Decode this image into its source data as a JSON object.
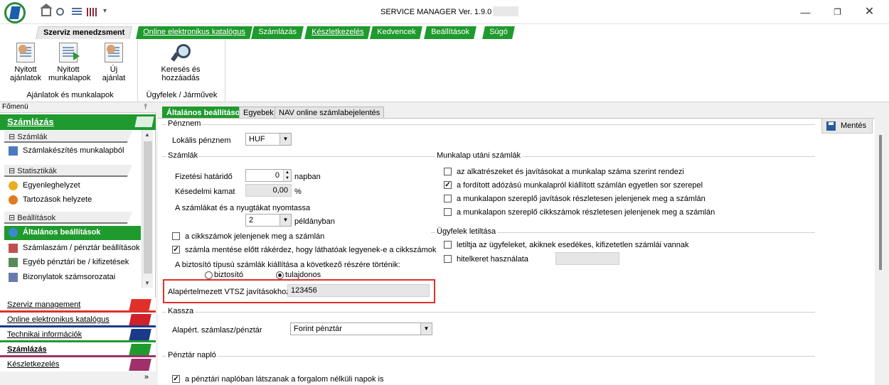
{
  "window": {
    "title": "SERVICE MANAGER Ver. 1.9.0",
    "qa_dropdown": "▾",
    "min": "—",
    "max": "❐",
    "close": "✕"
  },
  "ribbon": {
    "tabs": [
      {
        "label": "Szerviz menedzsment",
        "active": true
      },
      {
        "label": "Online elektronikus katalógus"
      },
      {
        "label": "Számlázás"
      },
      {
        "label": "Készletkezelés"
      },
      {
        "label": "Kedvencek"
      },
      {
        "label": "Beállítások"
      },
      {
        "label": "Súgó"
      }
    ],
    "groups": [
      {
        "label": "Ajánlatok és munkalapok",
        "buttons": [
          "Nyitott ajánlatok",
          "Nyitott munkalapok",
          "Új ajánlat"
        ]
      },
      {
        "label": "Ügyfelek / Járművek",
        "buttons": [
          "Keresés és hozzáadás"
        ]
      }
    ],
    "btn_lines": {
      "b0": [
        "Nyitott",
        "ajánlatok"
      ],
      "b1": [
        "Nyitott",
        "munkalapok"
      ],
      "b2": [
        "Új",
        "ajánlat"
      ],
      "b3": [
        "Keresés és",
        "hozzáadás"
      ]
    }
  },
  "left_panel": {
    "title": "Főmenü",
    "pin": "⫯",
    "module": "Számlázás",
    "groups": {
      "szamlak": "Számlák",
      "statisztikak": "Statisztikák",
      "beallitasok": "Beállítások",
      "expander": "⊟"
    },
    "items": {
      "szamlakeszites": "Számlakészítés munkalapból",
      "egyenleg": "Egyenleghelyzet",
      "tartozasok": "Tartozások helyzete",
      "altalanos": "Általános beállítások",
      "szamlaszam": "Számlaszám / pénztár beállítások",
      "egyeb": "Egyéb pénztári be / kifizetések",
      "bizonylatok": "Bizonylatok számsorozatai"
    },
    "modules": [
      {
        "label": "Szerviz management",
        "color": "#e0302a"
      },
      {
        "label": "Online elektronikus katalógus",
        "color": "#d0202a"
      },
      {
        "label": "Technikai információk",
        "color": "#1a3a8a"
      },
      {
        "label": "Számlázás",
        "color": "#1f9a2e"
      },
      {
        "label": "Készletkezelés",
        "color": "#a0306a"
      }
    ],
    "more": "»"
  },
  "main": {
    "tabs": [
      {
        "label": "Általános beállítások",
        "active": true
      },
      {
        "label": "Egyebek"
      },
      {
        "label": "NAV online számlabejelentés"
      }
    ],
    "save_label": "Mentés",
    "penznem": {
      "legend": "Pénznem",
      "currency_label": "Lokális pénznem",
      "currency_value": "HUF"
    },
    "szamlak": {
      "legend": "Számlák",
      "fizetesi_label": "Fizetési határidő",
      "fizetesi_value": "0",
      "fizetesi_unit": "napban",
      "kesedelmi_label": "Késedelmi kamat",
      "kesedelmi_value": "0,00",
      "kesedelmi_unit": "%",
      "nyomtat_label": "A számlákat és a nyugtákat nyomtassa",
      "nyomtat_value": "2",
      "nyomtat_unit": "példányban",
      "cikkszam_chk": "a cikkszámok jelenjenek meg a számlán",
      "mentes_chk": "számla mentése előtt rákérdez, hogy láthatóak legyenek-e a cikkszámok",
      "biztosito_label": "A biztosító típusú számlák kiállítása a következő részére történik:",
      "radio_biztosito": "biztosító",
      "radio_tulajdonos": "tulajdonos",
      "vtsz_label": "Alapértelmezett VTSZ javításokhoz",
      "vtsz_value": "123456"
    },
    "munkalap": {
      "legend": "Munkalap utáni számlák",
      "opt1": "az alkatrészeket és javításokat a munkalap száma szerint rendezi",
      "opt2": "a fordított adózású munkalapról kiállított számlán egyetlen sor szerepel",
      "opt3": "a munkalapon szereplő javítások részletesen jelenjenek meg a számlán",
      "opt4": "a munkalapon szereplő cikkszámok részletesen jelenjenek meg a számlán"
    },
    "ugyfelek": {
      "legend": "Ügyfelek letiltása",
      "opt1": "letiltja az ügyfeleket, akiknek esedékes, kifizetetlen számlái vannak",
      "opt2": "hitelkeret használata"
    },
    "kassza": {
      "legend": "Kassza",
      "label": "Alapért. számlasz/pénztár",
      "value": "Forint pénztár"
    },
    "naplo": {
      "legend": "Pénztár napló",
      "opt1": "a pénztári naplóban látszanak a forgalom nélküli napok is"
    }
  }
}
